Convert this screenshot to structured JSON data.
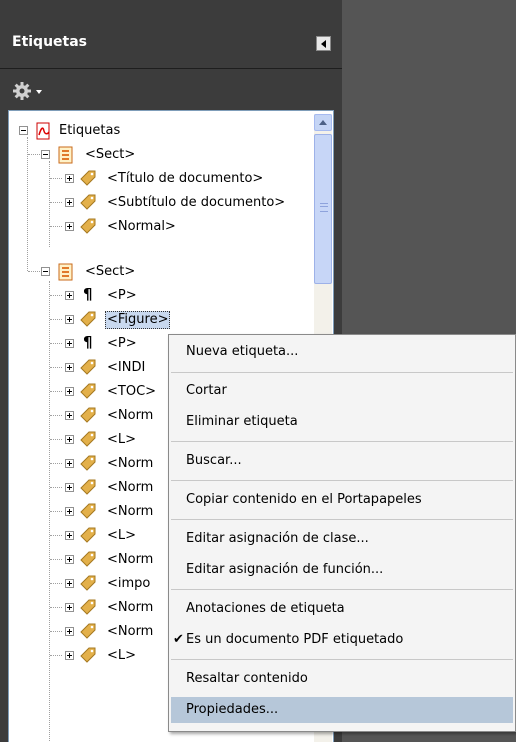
{
  "panel": {
    "title": "Etiquetas"
  },
  "tree": {
    "root": "Etiquetas",
    "rows": [
      {
        "label": "Etiquetas",
        "icon": "pdf-icon",
        "exp": "minus"
      },
      {
        "label": "<Sect>",
        "icon": "section-icon",
        "exp": "minus"
      },
      {
        "label": "<Título de documento>",
        "icon": "tag-icon",
        "exp": "plus"
      },
      {
        "label": "<Subtítulo de documento>",
        "icon": "tag-icon",
        "exp": "plus"
      },
      {
        "label": "<Normal>",
        "icon": "tag-icon",
        "exp": "plus"
      },
      {
        "label": "<Sect>",
        "icon": "section-icon",
        "exp": "minus"
      },
      {
        "label": "<P>",
        "icon": "paragraph-icon",
        "exp": "plus"
      },
      {
        "label": "<Figure>",
        "icon": "tag-icon",
        "exp": "plus",
        "selected": true
      },
      {
        "label": "<P>",
        "icon": "paragraph-icon",
        "exp": "plus"
      },
      {
        "label": "<INDI",
        "icon": "tag-icon",
        "exp": "plus"
      },
      {
        "label": "<TOC>",
        "icon": "tag-icon",
        "exp": "plus"
      },
      {
        "label": "<Norm",
        "icon": "tag-icon",
        "exp": "plus"
      },
      {
        "label": "<L>",
        "icon": "tag-icon",
        "exp": "plus"
      },
      {
        "label": "<Norm",
        "icon": "tag-icon",
        "exp": "plus"
      },
      {
        "label": "<Norm",
        "icon": "tag-icon",
        "exp": "plus"
      },
      {
        "label": "<Norm",
        "icon": "tag-icon",
        "exp": "plus"
      },
      {
        "label": "<L>",
        "icon": "tag-icon",
        "exp": "plus"
      },
      {
        "label": "<Norm",
        "icon": "tag-icon",
        "exp": "plus"
      },
      {
        "label": "<impo",
        "icon": "tag-icon",
        "exp": "plus"
      },
      {
        "label": "<Norm",
        "icon": "tag-icon",
        "exp": "plus"
      },
      {
        "label": "<Norm",
        "icon": "tag-icon",
        "exp": "plus"
      },
      {
        "label": "<L>",
        "icon": "tag-icon",
        "exp": "plus"
      }
    ]
  },
  "menu": {
    "items": [
      {
        "label": "Nueva etiqueta..."
      },
      {
        "label": "Cortar"
      },
      {
        "label": "Eliminar etiqueta"
      },
      {
        "label": "Buscar..."
      },
      {
        "label": "Copiar contenido en el Portapapeles"
      },
      {
        "label": "Editar asignación de clase..."
      },
      {
        "label": "Editar asignación de función..."
      },
      {
        "label": "Anotaciones de etiqueta"
      },
      {
        "label": "Es un documento PDF etiquetado",
        "checked": true
      },
      {
        "label": "Resaltar contenido"
      },
      {
        "label": "Propiedades...",
        "highlighted": true
      }
    ]
  },
  "colors": {
    "panel_bg": "#3c3c3c",
    "selection": "#c9d9ef",
    "menu_highlight": "#b6c7d9"
  }
}
